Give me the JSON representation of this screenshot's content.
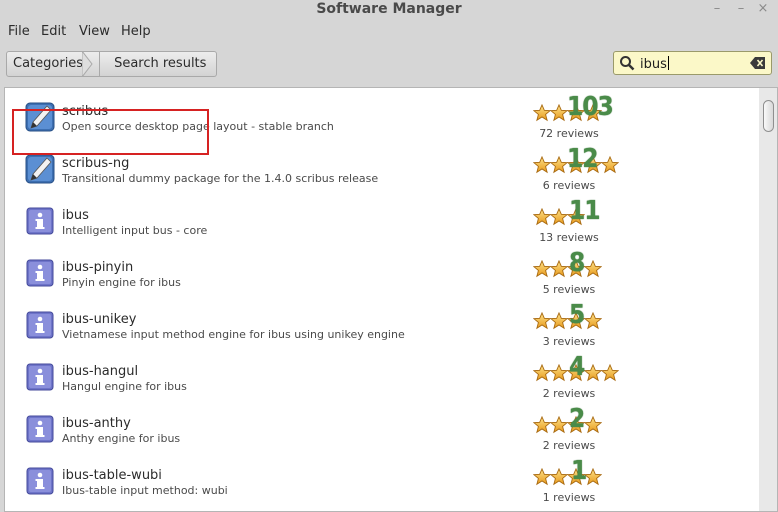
{
  "window": {
    "title": "Software Manager",
    "buttons": [
      "–",
      "–",
      "×"
    ]
  },
  "menu": [
    "File",
    "Edit",
    "View",
    "Help"
  ],
  "breadcrumb": [
    "Categories",
    "Search results"
  ],
  "search": {
    "value": "ibus"
  },
  "colors": {
    "highlight": "#d62222",
    "count": "#4a8b49",
    "search_bg": "#fbf8c8"
  },
  "apps": [
    {
      "name": "scribus",
      "summary": "Open source desktop page layout - stable branch",
      "icon": "scribus-icon",
      "rating": 4,
      "count": "103",
      "reviews": "72 reviews"
    },
    {
      "name": "scribus-ng",
      "summary": "Transitional dummy package for the 1.4.0 scribus release",
      "icon": "scribus-icon",
      "rating": 5,
      "count": "12",
      "reviews": "6 reviews"
    },
    {
      "name": "ibus",
      "summary": "Intelligent input bus - core",
      "icon": "info-icon",
      "rating": 3,
      "count": "11",
      "reviews": "13 reviews"
    },
    {
      "name": "ibus-pinyin",
      "summary": "Pinyin engine for ibus",
      "icon": "info-icon",
      "rating": 4,
      "count": "8",
      "reviews": "5 reviews"
    },
    {
      "name": "ibus-unikey",
      "summary": "Vietnamese input method engine for ibus using unikey engine",
      "icon": "info-icon",
      "rating": 4,
      "count": "5",
      "reviews": "3 reviews"
    },
    {
      "name": "ibus-hangul",
      "summary": "Hangul engine for ibus",
      "icon": "info-icon",
      "rating": 5,
      "count": "4",
      "reviews": "2 reviews"
    },
    {
      "name": "ibus-anthy",
      "summary": "Anthy engine for ibus",
      "icon": "info-icon",
      "rating": 4,
      "count": "2",
      "reviews": "2 reviews"
    },
    {
      "name": "ibus-table-wubi",
      "summary": "Ibus-table input method: wubi",
      "icon": "info-icon",
      "rating": 4,
      "count": "1",
      "reviews": "1 reviews"
    }
  ]
}
